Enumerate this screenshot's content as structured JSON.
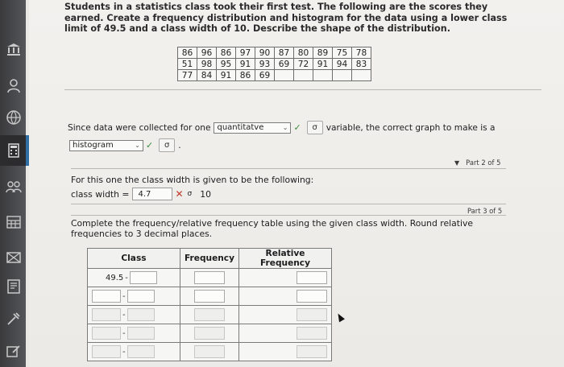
{
  "question": "Students in a statistics class took their first test. The following are the scores they earned. Create a frequency distribution and histogram for the data using a lower class limit of 49.5 and a class width of 10. Describe the shape of the distribution.",
  "scores": [
    [
      "86",
      "96",
      "86",
      "97",
      "90",
      "87",
      "80",
      "89",
      "75",
      "78"
    ],
    [
      "51",
      "98",
      "95",
      "91",
      "93",
      "69",
      "72",
      "91",
      "94",
      "83"
    ],
    [
      "77",
      "84",
      "91",
      "86",
      "69",
      "",
      "",
      "",
      "",
      ""
    ]
  ],
  "part1": {
    "text_before": "Since data were collected for one",
    "variable_select": "quantitatve",
    "text_after": "variable, the correct graph to make is a",
    "graph_select": "histogram",
    "period": "."
  },
  "part2": {
    "label": "Part 2 of 5",
    "prompt": "For this one the class width is given to be the following:",
    "field_label": "class width =",
    "entered_value": "4.7",
    "correct_value": "10"
  },
  "part3": {
    "label": "Part 3 of 5",
    "prompt": "Complete the frequency/relative frequency table using the given class width. Round relative frequencies to 3 decimal places.",
    "headers": [
      "Class",
      "Frequency",
      "Relative Frequency"
    ],
    "first_class_lower": "49.5",
    "first_class_dash": "-",
    "row_dash": "-"
  },
  "icons": {
    "check": "✓",
    "cross": "✕",
    "sigma": "σ",
    "chevron": "⌄",
    "triangle": "▼"
  },
  "colors": {
    "check_green": "#3b8a3b",
    "cross_red": "#c0392b",
    "sidebar_dark": "#3a3a3c"
  }
}
